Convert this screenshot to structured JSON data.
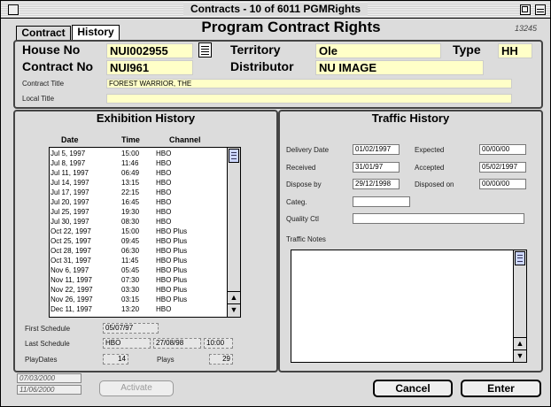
{
  "window": {
    "title": "Contracts - 10 of 6011 PGMRights"
  },
  "tabs": [
    {
      "label": "Contract"
    },
    {
      "label": "History"
    }
  ],
  "header": {
    "title": "Program Contract Rights",
    "code": "13245"
  },
  "contract": {
    "house_no_label": "House No",
    "house_no": "NUI002955",
    "territory_label": "Territory",
    "territory": "Ole",
    "type_label": "Type",
    "type": "HH",
    "contract_no_label": "Contract No",
    "contract_no": "NUI961",
    "distributor_label": "Distributor",
    "distributor": "NU IMAGE",
    "contract_title_label": "Contract Title",
    "contract_title": "FOREST WARRIOR, THE",
    "local_title_label": "Local Title",
    "local_title": ""
  },
  "exhibition": {
    "title": "Exhibition History",
    "columns": [
      "Date",
      "Time",
      "Channel"
    ],
    "rows": [
      [
        "Jul 5, 1997",
        "15:00",
        "HBO"
      ],
      [
        "Jul 8, 1997",
        "11:46",
        "HBO"
      ],
      [
        "Jul 11, 1997",
        "06:49",
        "HBO"
      ],
      [
        "Jul 14, 1997",
        "13:15",
        "HBO"
      ],
      [
        "Jul 17, 1997",
        "22:15",
        "HBO"
      ],
      [
        "Jul 20, 1997",
        "16:45",
        "HBO"
      ],
      [
        "Jul 25, 1997",
        "19:30",
        "HBO"
      ],
      [
        "Jul 30, 1997",
        "08:30",
        "HBO"
      ],
      [
        "Oct 22, 1997",
        "15:00",
        "HBO Plus"
      ],
      [
        "Oct 25, 1997",
        "09:45",
        "HBO Plus"
      ],
      [
        "Oct 28, 1997",
        "06:30",
        "HBO Plus"
      ],
      [
        "Oct 31, 1997",
        "11:45",
        "HBO Plus"
      ],
      [
        "Nov 6, 1997",
        "05:45",
        "HBO Plus"
      ],
      [
        "Nov 11, 1997",
        "07:30",
        "HBO Plus"
      ],
      [
        "Nov 22, 1997",
        "03:30",
        "HBO Plus"
      ],
      [
        "Nov 26, 1997",
        "03:15",
        "HBO Plus"
      ],
      [
        "Dec 11, 1997",
        "13:20",
        "HBO"
      ]
    ],
    "first_schedule_label": "First Schedule",
    "first_schedule": "05/07/97",
    "last_schedule_label": "Last Schedule",
    "last_channel": "HBO",
    "last_date": "27/08/98",
    "last_time": "10:00",
    "play_dates_label": "PlayDates",
    "play_dates": "14",
    "plays_label": "Plays",
    "plays": "29"
  },
  "traffic": {
    "title": "Traffic History",
    "delivery_date_label": "Delivery Date",
    "delivery_date": "01/02/1997",
    "expected_label": "Expected",
    "expected": "00/00/00",
    "received_label": "Received",
    "received": "31/01/97",
    "accepted_label": "Accepted",
    "accepted": "05/02/1997",
    "dispose_by_label": "Dispose by",
    "dispose_by": "29/12/1998",
    "disposed_on_label": "Disposed on",
    "disposed_on": "00/00/00",
    "categ_label": "Categ.",
    "categ": "",
    "quality_label": "Quality Ctl",
    "quality": "",
    "notes_label": "Traffic Notes",
    "notes": ""
  },
  "footer": {
    "date1": "07/03/2000",
    "date2": "11/06/2000",
    "activate_label": "Activate",
    "cancel_label": "Cancel",
    "enter_label": "Enter"
  },
  "colors": {
    "field_yellow": "#ffffc8",
    "scroll_thumb": "#ccd6ff"
  }
}
